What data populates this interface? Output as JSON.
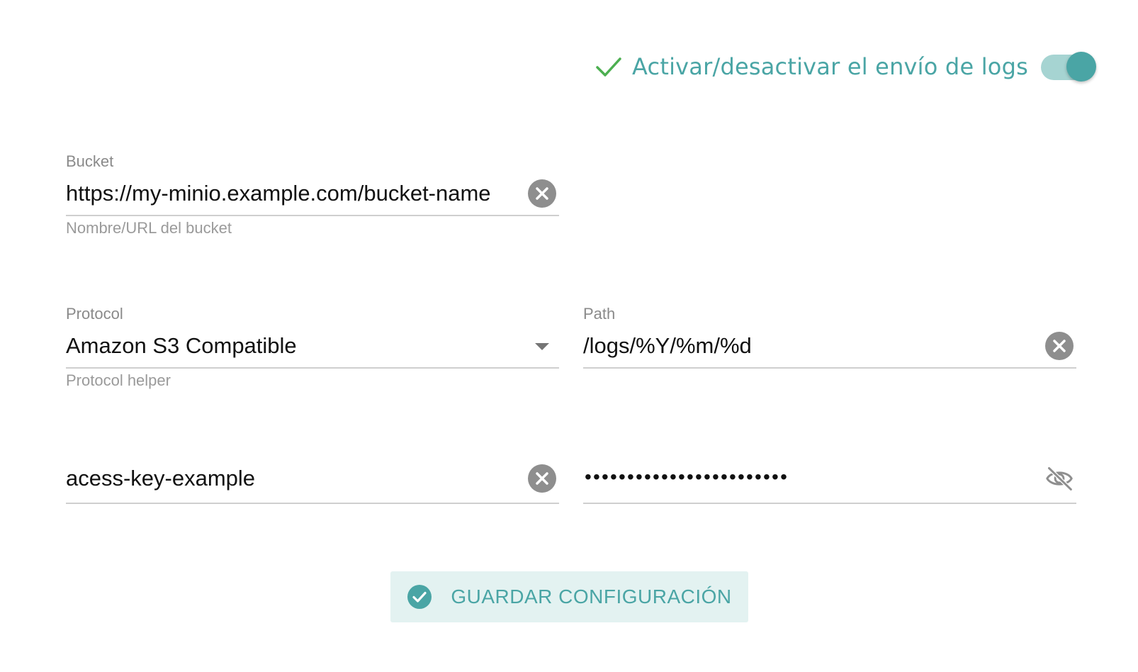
{
  "toggle": {
    "label": "Activar/desactivar el envío de logs",
    "enabled": true,
    "accent_color": "#4aa5a5",
    "check_color": "#4caf50"
  },
  "bucket": {
    "label": "Bucket",
    "value": "https://my-minio.example.com/bucket-name",
    "helper": "Nombre/URL del bucket",
    "clear_icon": "clear-icon"
  },
  "protocol": {
    "label": "Protocol",
    "value": "Amazon S3 Compatible",
    "helper": "Protocol helper",
    "dropdown_icon": "chevron-down-icon"
  },
  "path": {
    "label": "Path",
    "value": "/logs/%Y/%m/%d",
    "clear_icon": "clear-icon"
  },
  "access_key": {
    "value": "acess-key-example",
    "clear_icon": "clear-icon"
  },
  "secret_key": {
    "masked_value": "••••••••••••••••••••••••",
    "visibility_icon": "eye-off-icon"
  },
  "save_button": {
    "label": "GUARDAR CONFIGURACIÓN",
    "icon": "check-circle-icon",
    "background": "#e3f2f1"
  }
}
